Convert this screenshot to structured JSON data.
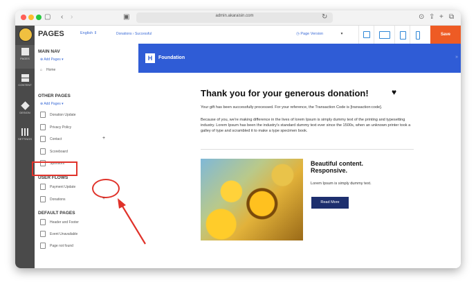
{
  "browser": {
    "url": "admin.akaraisin.com"
  },
  "rail": {
    "items": [
      {
        "label": "PAGES"
      },
      {
        "label": "CONTENT"
      },
      {
        "label": "DESIGN"
      },
      {
        "label": "SETTINGS"
      }
    ]
  },
  "panel": {
    "title": "PAGES",
    "language": "English",
    "main_nav": {
      "heading": "MAIN NAV",
      "add_label": "Add Pages",
      "pages": [
        "Home"
      ]
    },
    "other_pages": {
      "heading": "OTHER PAGES",
      "add_label": "Add Pages",
      "pages": [
        "Donation Update",
        "Privacy Policy",
        "Contact",
        "Scoreboard",
        "Sponsors"
      ]
    },
    "user_flows": {
      "heading": "USER FLOWS",
      "pages": [
        "Payment Update",
        "Donations"
      ]
    },
    "default_pages": {
      "heading": "DEFAULT PAGES",
      "pages": [
        "Header and Footer",
        "Event Unavailable",
        "Page not found"
      ]
    },
    "plus_symbol": "+"
  },
  "toolbar": {
    "breadcrumb": "Donations  ›  Successful",
    "page_version": "Page Version",
    "save_label": "Save"
  },
  "preview": {
    "logo_letter": "H",
    "site_name": "Foundation",
    "heading": "Thank you for your generous donation!",
    "heart": "♥",
    "paragraph1": "Your gift has been successfully processed. For your reference, the Transaction Code is [transaction:code].",
    "paragraph2": "Because of you, we're making difference in the lives of lorem Ipsum is simply dummy text of the printing and typesetting industry. Lorem Ipsum has been the industry's standard dummy text ever since the 1500s, when an unknown printer took a galley of type and scrambled it to make a type specimen book.",
    "card_title_line1": "Beautiful content.",
    "card_title_line2": "Responsive.",
    "card_text": "Lorem Ipsum is simply dummy text.",
    "card_button": "Read More"
  },
  "colors": {
    "accent": "#2f5cd6",
    "save": "#ee5b24",
    "annotation": "#e0322a"
  }
}
